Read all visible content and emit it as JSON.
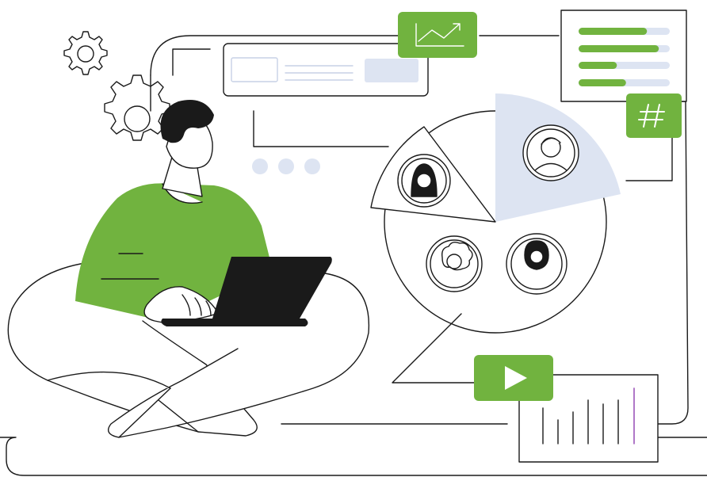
{
  "colors": {
    "accent_green": "#71b33f",
    "pale_blue": "#dde4f2",
    "bar_track": "#dde4f2",
    "stroke": "#1a1a1a",
    "laptop": "#1a1a1a",
    "bar_chart_accent": "#8e3fb0"
  },
  "icons": {
    "trend_badge": "trend-up-icon",
    "hash_badge": "hash-icon",
    "play_badge": "play-icon",
    "gears": "gear-icon"
  },
  "progress_bars": [
    {
      "level": 0.75
    },
    {
      "level": 0.88
    },
    {
      "level": 0.42
    },
    {
      "level": 0.52
    }
  ],
  "pie_chart": {
    "highlighted_segment": "top-right",
    "segments": 4
  }
}
